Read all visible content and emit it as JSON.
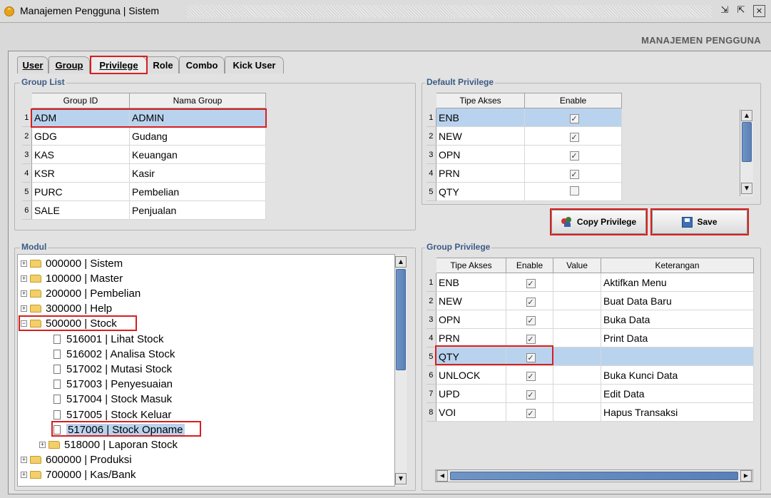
{
  "window": {
    "title": "Manajemen Pengguna | Sistem"
  },
  "page_header": "MANAJEMEN PENGGUNA",
  "tabs": [
    {
      "label": "User"
    },
    {
      "label": "Group"
    },
    {
      "label": "Privilege",
      "active": true
    },
    {
      "label": "Role"
    },
    {
      "label": "Combo"
    },
    {
      "label": "Kick User"
    }
  ],
  "group_list": {
    "title": "Group List",
    "columns": [
      "Group ID",
      "Nama Group"
    ],
    "rows": [
      {
        "num": "1",
        "id": "ADM",
        "name": "ADMIN"
      },
      {
        "num": "2",
        "id": "GDG",
        "name": "Gudang"
      },
      {
        "num": "3",
        "id": "KAS",
        "name": "Keuangan"
      },
      {
        "num": "4",
        "id": "KSR",
        "name": "Kasir"
      },
      {
        "num": "5",
        "id": "PURC",
        "name": "Pembelian"
      },
      {
        "num": "6",
        "id": "SALE",
        "name": "Penjualan"
      }
    ]
  },
  "default_privilege": {
    "title": "Default Privilege",
    "columns": [
      "Tipe Akses",
      "Enable"
    ],
    "rows": [
      {
        "num": "1",
        "tipe": "ENB",
        "enable": true
      },
      {
        "num": "2",
        "tipe": "NEW",
        "enable": true
      },
      {
        "num": "3",
        "tipe": "OPN",
        "enable": true
      },
      {
        "num": "4",
        "tipe": "PRN",
        "enable": true
      },
      {
        "num": "5",
        "tipe": "QTY",
        "enable": false
      }
    ]
  },
  "buttons": {
    "copy": "Copy Privilege",
    "save": "Save"
  },
  "modul": {
    "title": "Modul",
    "nodes": [
      {
        "label": "000000 | Sistem",
        "kind": "folder",
        "level": 0
      },
      {
        "label": "100000 | Master",
        "kind": "folder",
        "level": 0
      },
      {
        "label": "200000 | Pembelian",
        "kind": "folder",
        "level": 0
      },
      {
        "label": "300000 | Help",
        "kind": "folder",
        "level": 0
      },
      {
        "label": "500000 | Stock",
        "kind": "folder-open",
        "level": 0
      },
      {
        "label": "516001 | Lihat Stock",
        "kind": "file",
        "level": 1
      },
      {
        "label": "516002 | Analisa Stock",
        "kind": "file",
        "level": 1
      },
      {
        "label": "517002 | Mutasi Stock",
        "kind": "file",
        "level": 1
      },
      {
        "label": "517003 | Penyesuaian",
        "kind": "file",
        "level": 1
      },
      {
        "label": "517004 | Stock Masuk",
        "kind": "file",
        "level": 1
      },
      {
        "label": "517005 | Stock Keluar",
        "kind": "file",
        "level": 1
      },
      {
        "label": "517006 | Stock Opname",
        "kind": "file",
        "level": 1,
        "selected": true
      },
      {
        "label": "518000 | Laporan Stock",
        "kind": "folder",
        "level": 1
      },
      {
        "label": "600000 | Produksi",
        "kind": "folder",
        "level": 0
      },
      {
        "label": "700000 | Kas/Bank",
        "kind": "folder",
        "level": 0
      }
    ]
  },
  "group_privilege": {
    "title": "Group Privilege",
    "columns": [
      "Tipe Akses",
      "Enable",
      "Value",
      "Keterangan"
    ],
    "rows": [
      {
        "num": "1",
        "tipe": "ENB",
        "enable": true,
        "value": "",
        "ket": "Aktifkan Menu"
      },
      {
        "num": "2",
        "tipe": "NEW",
        "enable": true,
        "value": "",
        "ket": "Buat Data Baru"
      },
      {
        "num": "3",
        "tipe": "OPN",
        "enable": true,
        "value": "",
        "ket": "Buka Data"
      },
      {
        "num": "4",
        "tipe": "PRN",
        "enable": true,
        "value": "",
        "ket": "Print Data"
      },
      {
        "num": "5",
        "tipe": "QTY",
        "enable": true,
        "value": "",
        "ket": ""
      },
      {
        "num": "6",
        "tipe": "UNLOCK",
        "enable": true,
        "value": "",
        "ket": "Buka Kunci Data"
      },
      {
        "num": "7",
        "tipe": "UPD",
        "enable": true,
        "value": "",
        "ket": "Edit Data"
      },
      {
        "num": "8",
        "tipe": "VOI",
        "enable": true,
        "value": "",
        "ket": "Hapus Transaksi"
      }
    ]
  }
}
